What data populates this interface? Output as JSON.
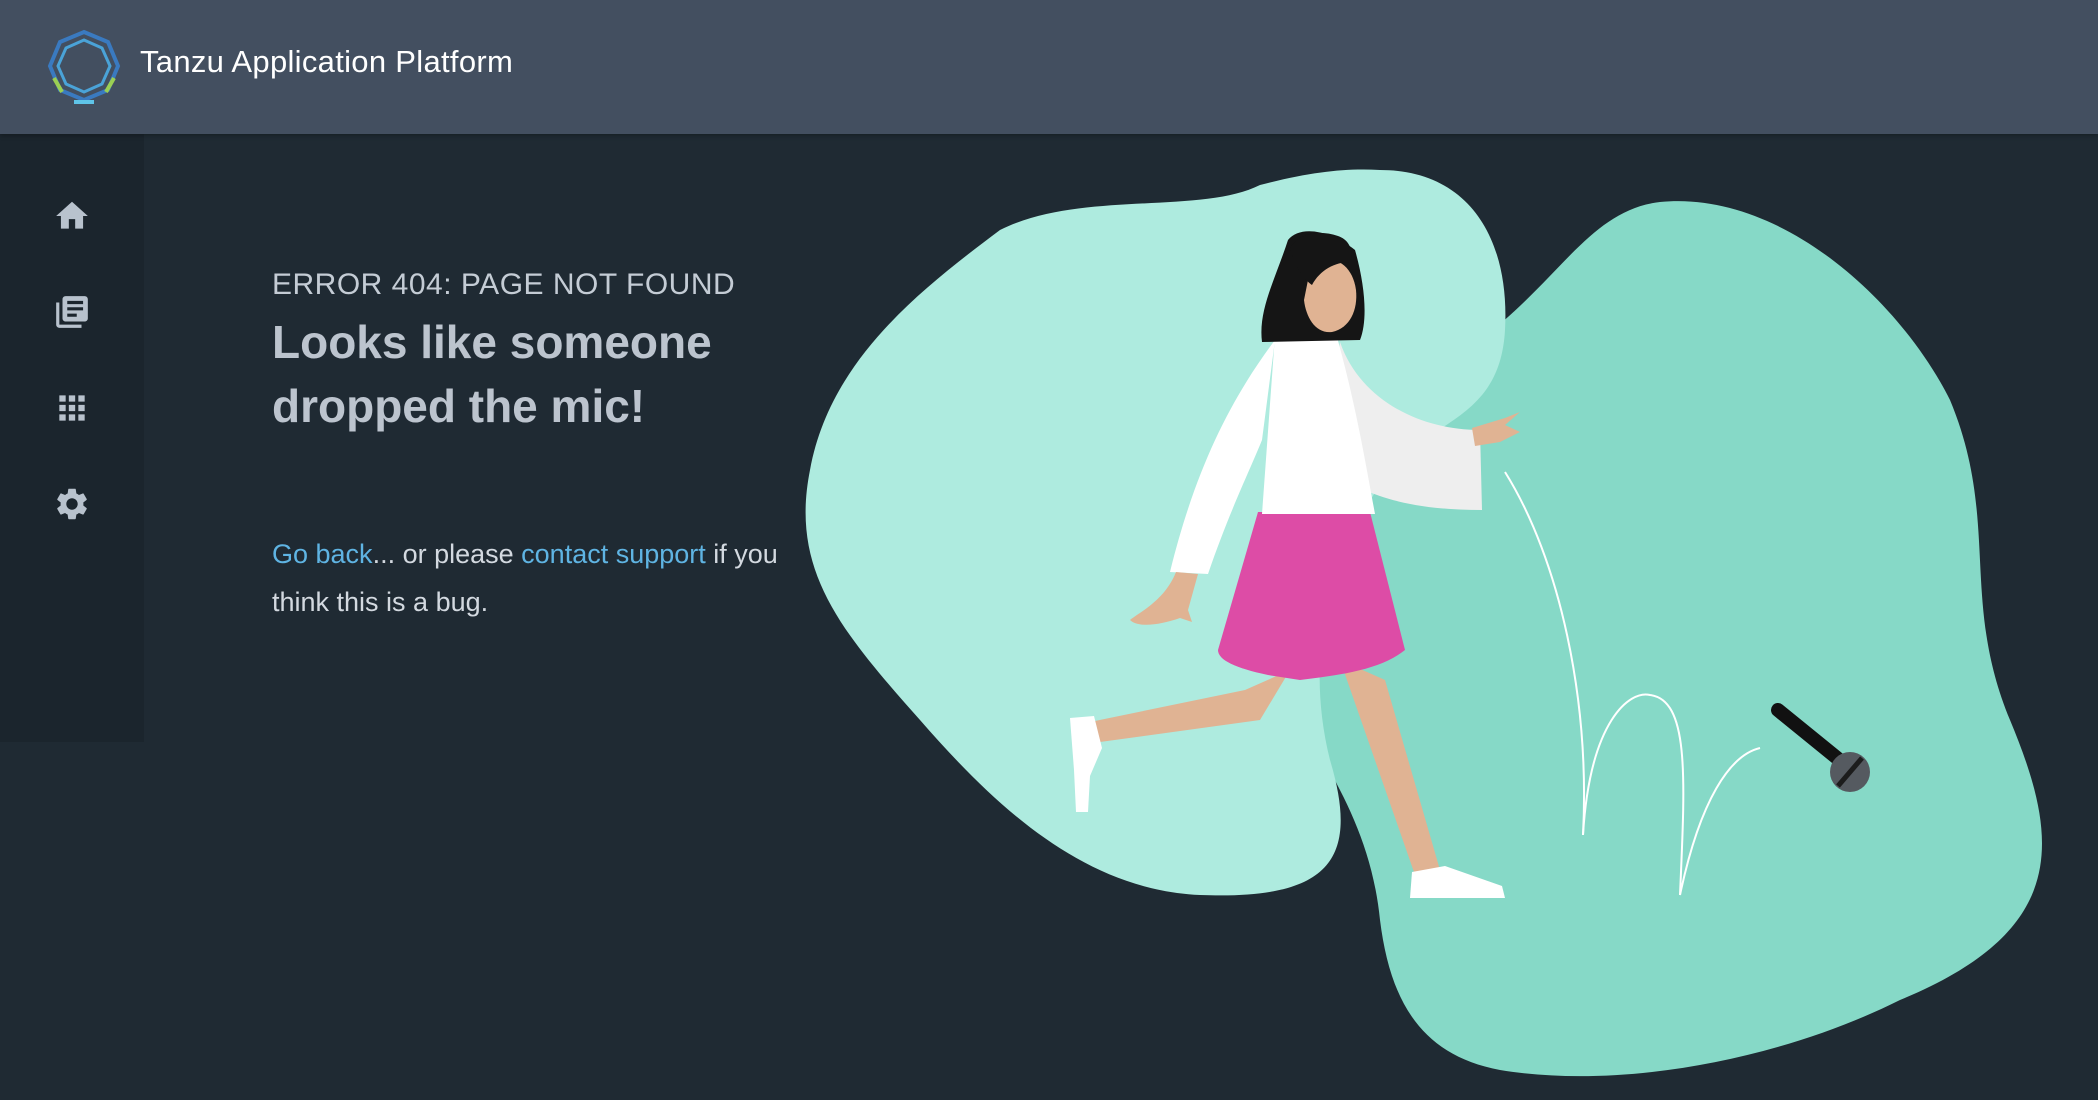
{
  "header": {
    "app_title": "Tanzu Application Platform",
    "logo_icon": "tanzu-logo"
  },
  "sidebar": {
    "items": [
      {
        "icon": "home-icon"
      },
      {
        "icon": "catalog-icon"
      },
      {
        "icon": "apps-grid-icon"
      },
      {
        "icon": "settings-gear-icon"
      }
    ]
  },
  "error": {
    "code_text": "ERROR 404: PAGE NOT FOUND",
    "headline": "Looks like someone dropped the mic!",
    "go_back_link": "Go back",
    "middle_text": "... or please ",
    "contact_link": "contact support",
    "end_text": " if you think this is a bug."
  },
  "colors": {
    "header_bg": "#434f60",
    "page_bg": "#1f2a33",
    "sidebar_bg": "#1b252d",
    "link": "#5fb4e3",
    "blob_light": "#aeebdf",
    "blob_dark": "#86d9c7",
    "skirt": "#dd4ca6"
  }
}
